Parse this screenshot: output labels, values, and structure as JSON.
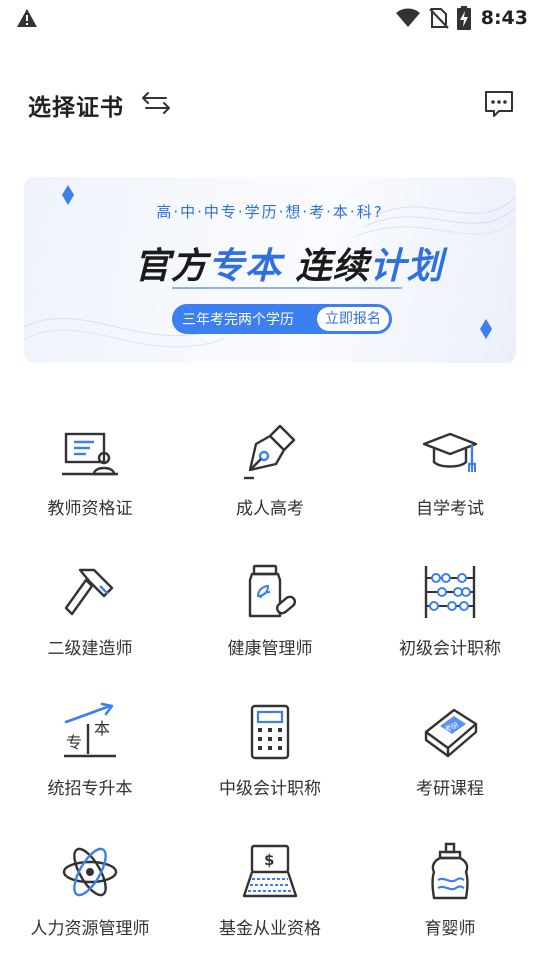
{
  "status_bar": {
    "time": "8:43",
    "icons": [
      "warning-icon",
      "wifi-icon",
      "no-sim-icon",
      "battery-charging-icon"
    ]
  },
  "header": {
    "title": "选择证书",
    "switch_icon": "swap-arrows-icon",
    "message_icon": "chat-bubble-icon"
  },
  "banner": {
    "subtitle": "高·中·中专·学历·想·考·本·科?",
    "headline_part1": "官方",
    "headline_part2": "专本",
    "headline_part3": " 连续",
    "headline_part4": "计划",
    "pill_text": "三年考完两个学历",
    "cta": "立即报名",
    "accent_color": "#2f6fe0"
  },
  "grid": {
    "items": [
      {
        "label": "教师资格证",
        "icon": "teacher-board-icon"
      },
      {
        "label": "成人高考",
        "icon": "pen-nib-icon"
      },
      {
        "label": "自学考试",
        "icon": "graduation-cap-icon"
      },
      {
        "label": "二级建造师",
        "icon": "hammer-icon"
      },
      {
        "label": "健康管理师",
        "icon": "medicine-bottle-icon"
      },
      {
        "label": "初级会计职称",
        "icon": "abacus-icon"
      },
      {
        "label": "统招专升本",
        "icon": "upgrade-arrow-icon"
      },
      {
        "label": "中级会计职称",
        "icon": "calculator-icon"
      },
      {
        "label": "考研课程",
        "icon": "book-icon"
      },
      {
        "label": "人力资源管理师",
        "icon": "atom-icon"
      },
      {
        "label": "基金从业资格",
        "icon": "laptop-dollar-icon"
      },
      {
        "label": "育婴师",
        "icon": "baby-bottle-icon"
      }
    ],
    "badge_text": "考研"
  }
}
